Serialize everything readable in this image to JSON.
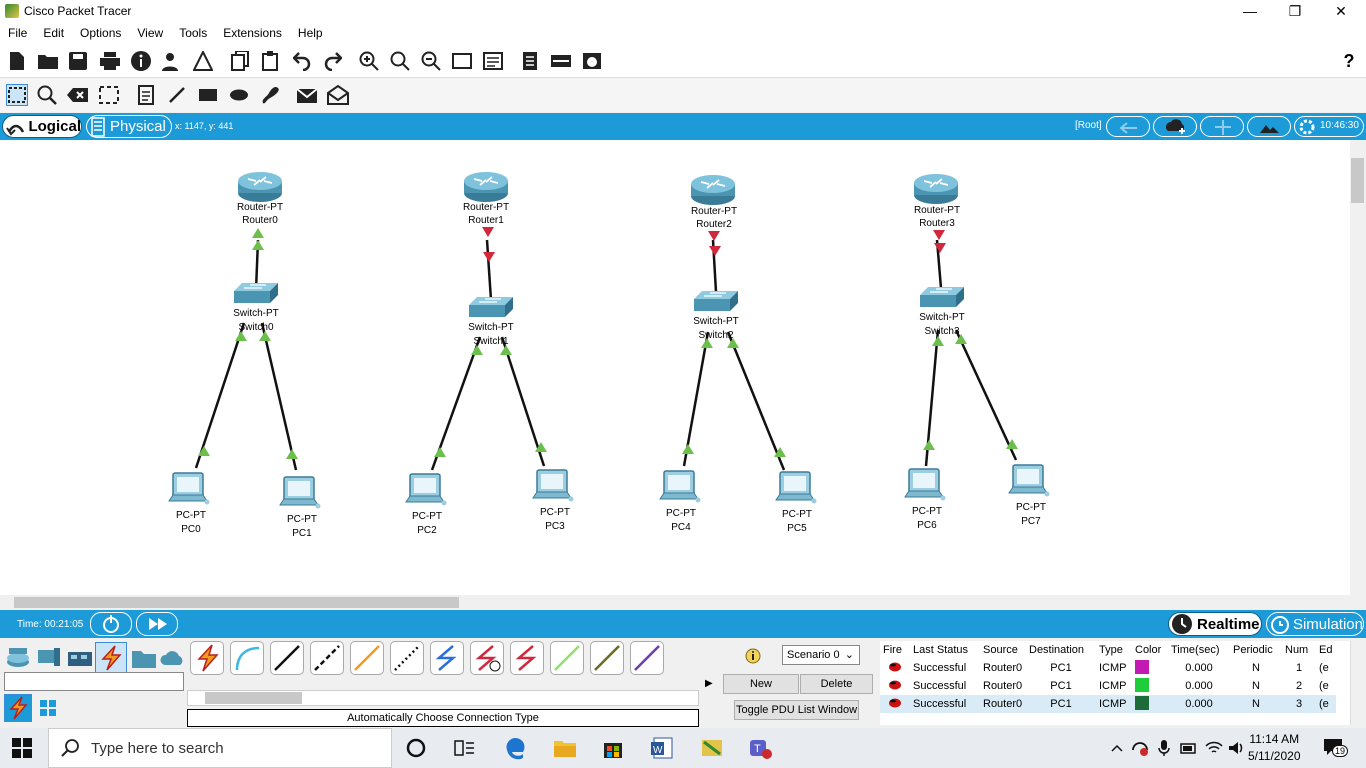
{
  "window": {
    "title": "Cisco Packet Tracer",
    "minimize": "—",
    "restore": "❐",
    "close": "✕"
  },
  "menu": [
    "File",
    "Edit",
    "Options",
    "View",
    "Tools",
    "Extensions",
    "Help"
  ],
  "help_icon": "?",
  "tabs": {
    "logical": "Logical",
    "physical": "Physical",
    "coords": "x: 1147, y: 441",
    "root": "[Root]",
    "clock": "10:46:30"
  },
  "devices": {
    "routers": [
      {
        "type": "Router-PT",
        "name": "Router0"
      },
      {
        "type": "Router-PT",
        "name": "Router1"
      },
      {
        "type": "Router-PT",
        "name": "Router2"
      },
      {
        "type": "Router-PT",
        "name": "Router3"
      }
    ],
    "switches": [
      {
        "type": "Switch-PT",
        "name": "Switch0"
      },
      {
        "type": "Switch-PT",
        "name": "Switch1"
      },
      {
        "type": "Switch-PT",
        "name": "Switch2"
      },
      {
        "type": "Switch-PT",
        "name": "Switch3"
      }
    ],
    "pcs": [
      {
        "type": "PC-PT",
        "name": "PC0"
      },
      {
        "type": "PC-PT",
        "name": "PC1"
      },
      {
        "type": "PC-PT",
        "name": "PC2"
      },
      {
        "type": "PC-PT",
        "name": "PC3"
      },
      {
        "type": "PC-PT",
        "name": "PC4"
      },
      {
        "type": "PC-PT",
        "name": "PC5"
      },
      {
        "type": "PC-PT",
        "name": "PC6"
      },
      {
        "type": "PC-PT",
        "name": "PC7"
      }
    ]
  },
  "timebar": {
    "time": "Time: 00:21:05",
    "realtime": "Realtime",
    "simulation": "Simulation"
  },
  "connection_label": "Automatically Choose Connection Type",
  "pdu": {
    "scenario": "Scenario 0",
    "new": "New",
    "delete": "Delete",
    "toggle": "Toggle PDU List Window",
    "columns": [
      "Fire",
      "Last Status",
      "Source",
      "Destination",
      "Type",
      "Color",
      "Time(sec)",
      "Periodic",
      "Num",
      "Ed"
    ],
    "rows": [
      {
        "status": "Successful",
        "source": "Router0",
        "dest": "PC1",
        "type": "ICMP",
        "color": "#c41ab4",
        "time": "0.000",
        "periodic": "N",
        "num": "1",
        "edit": "(e"
      },
      {
        "status": "Successful",
        "source": "Router0",
        "dest": "PC1",
        "type": "ICMP",
        "color": "#1fcc3a",
        "time": "0.000",
        "periodic": "N",
        "num": "2",
        "edit": "(e"
      },
      {
        "status": "Successful",
        "source": "Router0",
        "dest": "PC1",
        "type": "ICMP",
        "color": "#1e6b3a",
        "time": "0.000",
        "periodic": "N",
        "num": "3",
        "edit": "(e"
      }
    ]
  },
  "taskbar": {
    "search_placeholder": "Type here to search",
    "time": "11:14 AM",
    "date": "5/11/2020",
    "notifications": "19"
  },
  "colors": {
    "accent": "#1c9bd8",
    "link_up": "#6cbf4a",
    "link_down": "#d0283c"
  }
}
